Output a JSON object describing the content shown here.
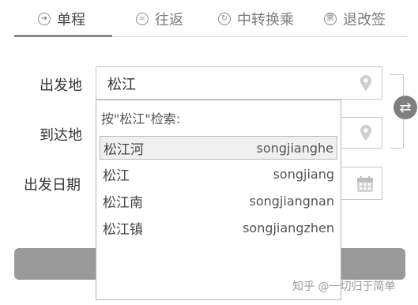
{
  "tabs": [
    {
      "label": "单程",
      "icon": "arrow-circle-icon"
    },
    {
      "label": "往返",
      "icon": "equals-circle-icon"
    },
    {
      "label": "中转换乘",
      "icon": "transfer-circle-icon"
    },
    {
      "label": "退改签",
      "icon": "ticket-circle-icon"
    }
  ],
  "form": {
    "from_label": "出发地",
    "from_value": "松江",
    "to_label": "到达地",
    "date_label": "出发日期"
  },
  "dropdown": {
    "header": "按\"松江\"检索:",
    "items": [
      {
        "name": "松江河",
        "pinyin": "songjianghe"
      },
      {
        "name": "松江",
        "pinyin": "songjiang"
      },
      {
        "name": "松江南",
        "pinyin": "songjiangnan"
      },
      {
        "name": "松江镇",
        "pinyin": "songjiangzhen"
      }
    ]
  },
  "watermark": "知乎 @一切归于简单",
  "colors": {
    "accent": "#7f7f7f",
    "border": "#c8c8c8",
    "highlight": "#f0f0f0"
  }
}
